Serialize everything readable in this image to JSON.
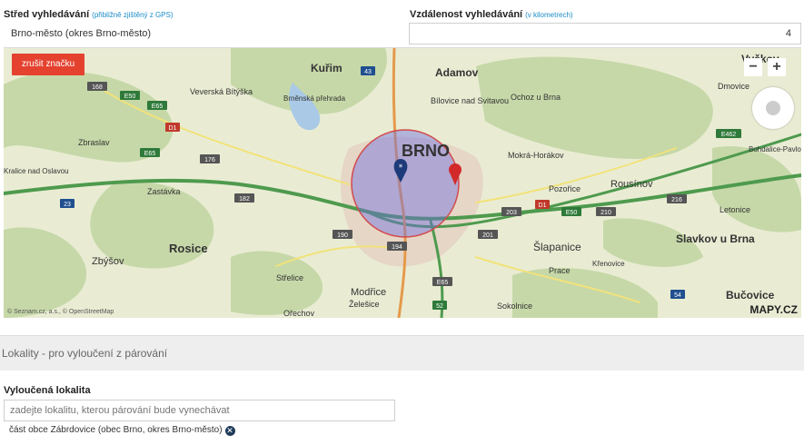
{
  "search_center": {
    "label": "Střed vyhledávání",
    "hint": "(přibližně zjištěný z GPS)",
    "value": "Brno-město (okres Brno-město)"
  },
  "search_distance": {
    "label": "Vzdálenost vyhledávání",
    "hint": "(v kilometrech)",
    "value": "4"
  },
  "map": {
    "remove_marker_label": "zrušit značku",
    "zoom_out": "−",
    "zoom_in": "+",
    "attribution": "© Seznam.cz, a.s., © OpenStreetMap",
    "logo": "MAPY.CZ",
    "towns": [
      "Kuřim",
      "Adamov",
      "Veverská Bítýška",
      "Brněnská přehrada",
      "Bílovice nad Svitavou",
      "Ochoz u Brna",
      "Dmovice",
      "Zbraslav",
      "BRNO",
      "Mokrá-Horákov",
      "Bohdalice-Pavlov",
      "Kralice nad Oslavou",
      "Zastávka",
      "Pozořice",
      "Rousínov",
      "Letonice",
      "Rosice",
      "Šlapanice",
      "Slavkov u Brna",
      "Zbýšov",
      "Prace",
      "Křenovice",
      "Střelice",
      "Modřice",
      "Želešice",
      "Ořechov",
      "Sokolnice",
      "Bučovice",
      "Vyškov"
    ],
    "road_labels": [
      "43",
      "168",
      "E50",
      "E65",
      "D1",
      "176",
      "182",
      "E462",
      "23",
      "190",
      "194",
      "201",
      "203",
      "210",
      "216",
      "D1",
      "E50",
      "54",
      "E65",
      "52",
      "E65"
    ]
  },
  "exclusions": {
    "section_title": "Lokality - pro vyloučení z párování",
    "field_label": "Vyloučená lokalita",
    "placeholder": "zadejte lokalitu, kterou párování bude vynechávat",
    "items": [
      "část obce Zábrdovice (obec Brno, okres Brno-město)"
    ]
  }
}
